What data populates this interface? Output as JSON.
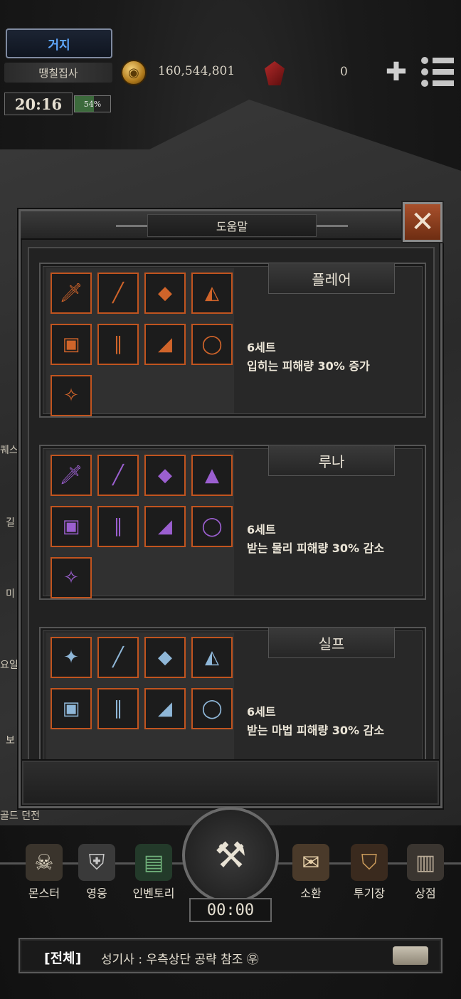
{
  "hud": {
    "rank": "거지",
    "player_name": "땡칠집사",
    "gold": "160,544,801",
    "gems": "0",
    "clock": "20:16",
    "battery_label": "54%",
    "battery_level": 0.54
  },
  "side_labels": [
    "퀘스",
    "길",
    "미",
    "요일",
    "보",
    "골드 던전"
  ],
  "modal": {
    "title": "도움말",
    "close_label": "✕",
    "sets": [
      {
        "name": "플레어",
        "count": "6세트",
        "effect": "입히는 피해량 30% 증가",
        "items": [
          "sword",
          "staff",
          "shield",
          "hood",
          "armor",
          "pants",
          "boots",
          "ring",
          "necklace"
        ],
        "item_glyphs": [
          "🗡",
          "╱",
          "◆",
          "◭",
          "▣",
          "∥",
          "◢",
          "◯",
          "✧"
        ],
        "item_color": "#d0642a"
      },
      {
        "name": "루나",
        "count": "6세트",
        "effect": "받는 물리 피해량 30% 감소",
        "items": [
          "sword",
          "spear",
          "shield",
          "hat",
          "robe",
          "pants",
          "boots",
          "ring",
          "necklace"
        ],
        "item_glyphs": [
          "🗡",
          "╱",
          "◆",
          "▲",
          "▣",
          "∥",
          "◢",
          "◯",
          "✧"
        ],
        "item_color": "#9b5fd0"
      },
      {
        "name": "실프",
        "count": "6세트",
        "effect": "받는 마법 피해량 30% 감소",
        "items": [
          "staff",
          "staff",
          "shield",
          "hood",
          "robe",
          "scarf",
          "boots",
          "ring"
        ],
        "item_glyphs": [
          "✦",
          "╱",
          "◆",
          "◭",
          "▣",
          "∥",
          "◢",
          "◯"
        ],
        "item_color": "#8fb7d8"
      }
    ]
  },
  "nav": {
    "items": [
      {
        "label": "몬스터",
        "icon": "☠"
      },
      {
        "label": "영웅",
        "icon": "⛨"
      },
      {
        "label": "인벤토리",
        "icon": "▤"
      },
      {
        "label": "소환",
        "icon": "✉"
      },
      {
        "label": "투기장",
        "icon": "⛉"
      },
      {
        "label": "상점",
        "icon": "▥"
      }
    ],
    "timer": "00:00"
  },
  "chat": {
    "channel": "[전체]",
    "message": "성기사 : 우측상단 공략 참조 ㉾"
  },
  "colors": {
    "accent_orange": "#c1541f",
    "rank_blue": "#5fa8ff"
  }
}
